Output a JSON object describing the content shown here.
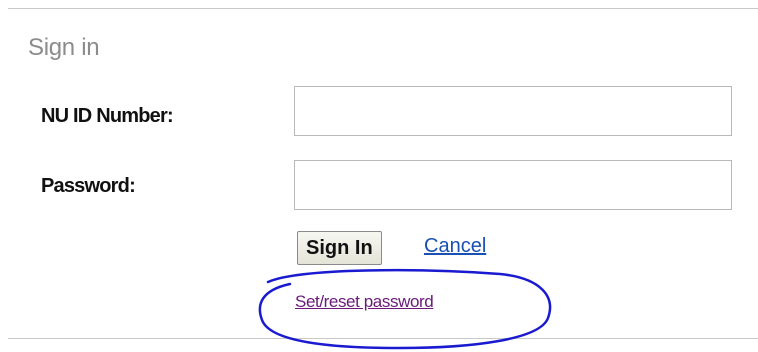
{
  "signin": {
    "title": "Sign in",
    "id_label": "NU ID Number:",
    "id_value": "",
    "password_label": "Password:",
    "password_value": "",
    "signin_button": "Sign In",
    "cancel_link": "Cancel",
    "reset_link": "Set/reset password"
  },
  "colors": {
    "annotation_stroke": "#1a1ad0",
    "link_color": "#1a4fb4",
    "visited_link_color": "#6b1a7a"
  }
}
